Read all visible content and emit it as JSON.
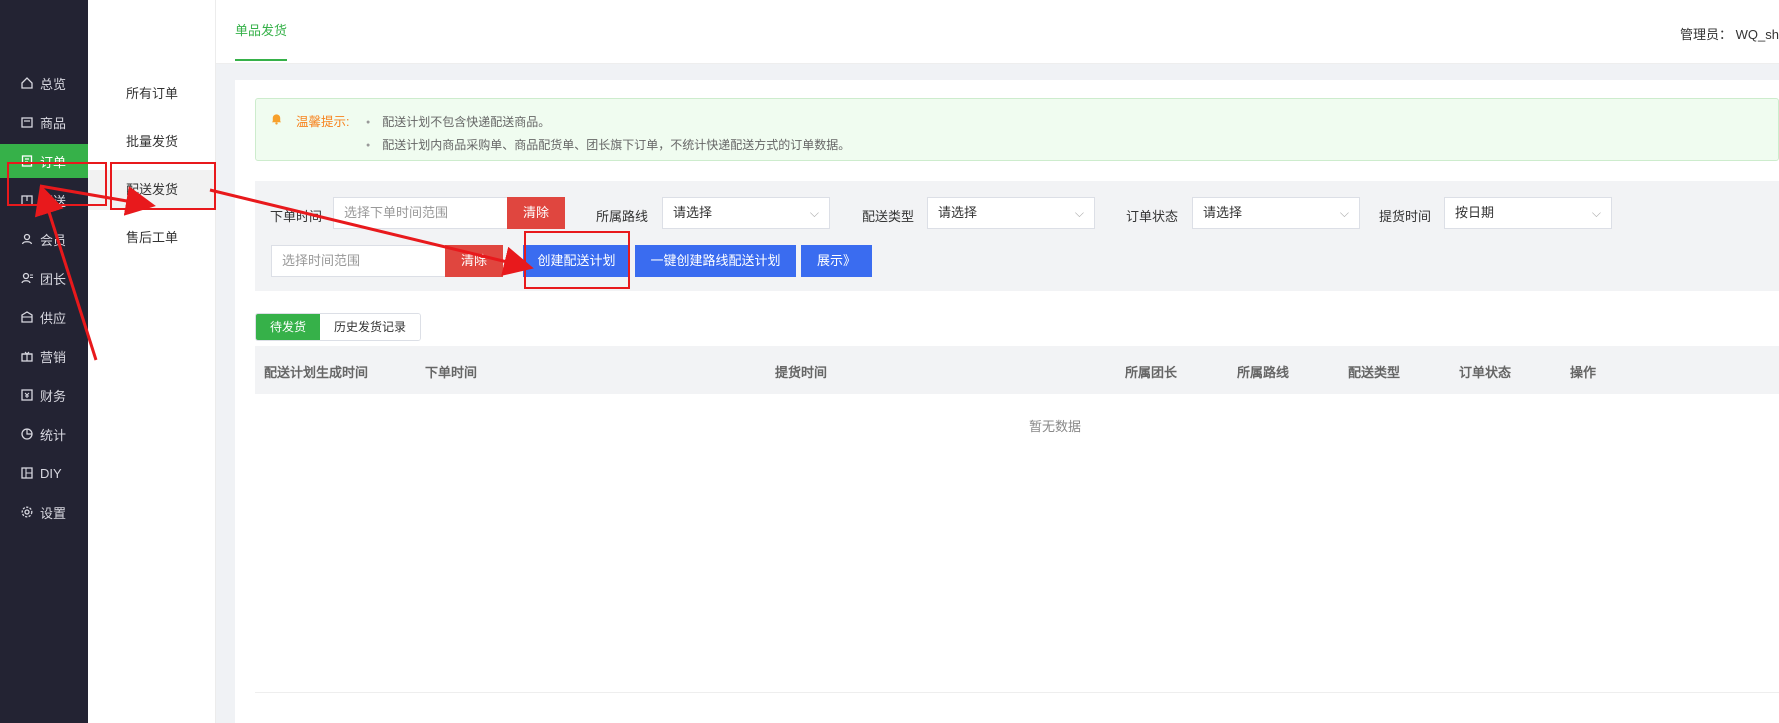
{
  "nav": {
    "items": [
      {
        "label": "总览",
        "icon": "home-icon"
      },
      {
        "label": "商品",
        "icon": "box-icon"
      },
      {
        "label": "订单",
        "icon": "order-icon"
      },
      {
        "label": "配送",
        "icon": "delivery-icon"
      },
      {
        "label": "会员",
        "icon": "user-icon"
      },
      {
        "label": "团长",
        "icon": "leader-icon"
      },
      {
        "label": "供应",
        "icon": "supply-icon"
      },
      {
        "label": "营销",
        "icon": "gift-icon"
      },
      {
        "label": "财务",
        "icon": "finance-icon"
      },
      {
        "label": "统计",
        "icon": "pie-icon"
      },
      {
        "label": "DIY",
        "icon": "diy-icon"
      },
      {
        "label": "设置",
        "icon": "gear-icon"
      }
    ],
    "active_index": 2
  },
  "subnav": {
    "items": [
      "所有订单",
      "批量发货",
      "配送发货",
      "售后工单"
    ],
    "active_index": 2
  },
  "header": {
    "tab": "单品发货",
    "admin": "管理员： WQ_sh"
  },
  "notice": {
    "title": "温馨提示:",
    "lines": [
      "配送计划不包含快递配送商品。",
      "配送计划内商品采购单、商品配货单、团长旗下订单，不统计快递配送方式的订单数据。"
    ]
  },
  "filters": {
    "order_time_label": "下单时间",
    "order_time_placeholder": "选择下单时间范围",
    "clear": "清除",
    "route_label": "所属路线",
    "route_value": "请选择",
    "delivery_type_label": "配送类型",
    "delivery_type_value": "请选择",
    "order_status_label": "订单状态",
    "order_status_value": "请选择",
    "pickup_label": "提货时间",
    "pickup_value": "按日期",
    "time_range_placeholder": "选择时间范围",
    "clear2": "清除",
    "create_plan": "创建配送计划",
    "create_route_plan": "一键创建路线配送计划",
    "expand": "展示》"
  },
  "tabs": [
    "待发货",
    "历史发货记录"
  ],
  "table": {
    "columns": [
      "配送计划生成时间",
      "下单时间",
      "提货时间",
      "所属团长",
      "所属路线",
      "配送类型",
      "订单状态",
      "操作"
    ],
    "empty_text": "暂无数据"
  },
  "colors": {
    "accent": "#36b149",
    "nav_bg": "#232333",
    "primary_button": "#3a6cf0",
    "danger_button": "#e0463f",
    "annotation": "#e8191c"
  }
}
